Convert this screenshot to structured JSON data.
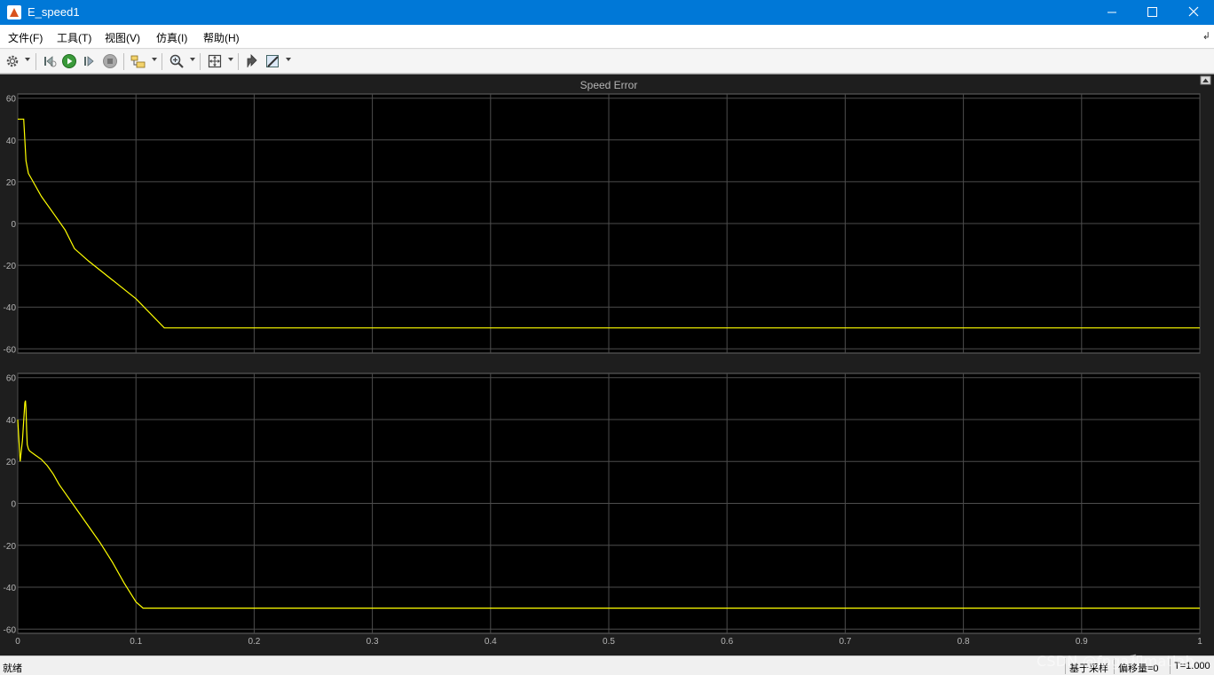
{
  "window": {
    "title": "E_speed1",
    "controls": [
      "minimize-icon",
      "maximize-icon",
      "close-icon"
    ]
  },
  "menu": {
    "items": [
      "文件(F)",
      "工具(T)",
      "视图(V)",
      "仿真(I)",
      "帮助(H)"
    ]
  },
  "toolbar": {
    "icons": [
      "gear-icon",
      "step-back-icon",
      "run-icon",
      "step-forward-icon",
      "stop-icon",
      "highlight-block-icon",
      "zoom-icon",
      "fit-to-view-icon",
      "restore-icon",
      "style-icon"
    ]
  },
  "colors": {
    "titlebar": "#0078d7",
    "plot_background": "#000000",
    "frame_background": "#1e1e1e",
    "trace": "#ffff00",
    "grid": "#4d4d4d"
  },
  "status": {
    "left": "就绪",
    "sample_based": "基于采样",
    "offset": "偏移量=0",
    "time": "T=1.000"
  },
  "watermark": "CSDN @fpga和matlab",
  "chart_data": [
    {
      "type": "line",
      "title": "Speed Error",
      "xlim": [
        0,
        1
      ],
      "ylim": [
        -62,
        62
      ],
      "x_ticks": [
        "0",
        "0.1",
        "0.2",
        "0.3",
        "0.4",
        "0.5",
        "0.6",
        "0.7",
        "0.8",
        "0.9",
        "1"
      ],
      "y_ticks": [
        "60",
        "40",
        "20",
        "0",
        "-20",
        "-40",
        "-60"
      ],
      "y_tick_values": [
        60,
        40,
        20,
        0,
        -20,
        -40,
        -60
      ],
      "x_tick_values": [
        0,
        0.1,
        0.2,
        0.3,
        0.4,
        0.5,
        0.6,
        0.7,
        0.8,
        0.9,
        1.0
      ],
      "grid": true,
      "series": [
        {
          "x": [
            0,
            0.005,
            0.006,
            0.007,
            0.009,
            0.012,
            0.02,
            0.03,
            0.04,
            0.048,
            0.06,
            0.08,
            0.1,
            0.124,
            0.2,
            0.4,
            0.6,
            0.8,
            1.0
          ],
          "y": [
            50,
            50,
            40,
            30,
            24,
            21,
            13,
            5,
            -3,
            -12,
            -18,
            -27,
            -36,
            -50,
            -50,
            -50,
            -50,
            -50,
            -50
          ]
        }
      ]
    },
    {
      "type": "line",
      "title": "",
      "xlim": [
        0,
        1
      ],
      "ylim": [
        -62,
        62
      ],
      "x_ticks": [
        "0",
        "0.1",
        "0.2",
        "0.3",
        "0.4",
        "0.5",
        "0.6",
        "0.7",
        "0.8",
        "0.9",
        "1"
      ],
      "y_ticks": [
        "60",
        "40",
        "20",
        "0",
        "-20",
        "-40",
        "-60"
      ],
      "y_tick_values": [
        60,
        40,
        20,
        0,
        -20,
        -40,
        -60
      ],
      "x_tick_values": [
        0,
        0.1,
        0.2,
        0.3,
        0.4,
        0.5,
        0.6,
        0.7,
        0.8,
        0.9,
        1.0
      ],
      "grid": true,
      "series": [
        {
          "x": [
            0,
            0.002,
            0.004,
            0.006,
            0.0065,
            0.007,
            0.0075,
            0.008,
            0.009,
            0.01,
            0.015,
            0.02,
            0.025,
            0.03,
            0.035,
            0.04,
            0.05,
            0.06,
            0.07,
            0.08,
            0.09,
            0.1,
            0.106,
            0.2,
            0.4,
            0.6,
            0.8,
            1.0
          ],
          "y": [
            40,
            20,
            30,
            48,
            49,
            45,
            35,
            28,
            26,
            25,
            23,
            21,
            18,
            14,
            9,
            5,
            -3,
            -11,
            -19,
            -28,
            -38,
            -47,
            -50,
            -50,
            -50,
            -50,
            -50,
            -50
          ]
        }
      ]
    }
  ]
}
